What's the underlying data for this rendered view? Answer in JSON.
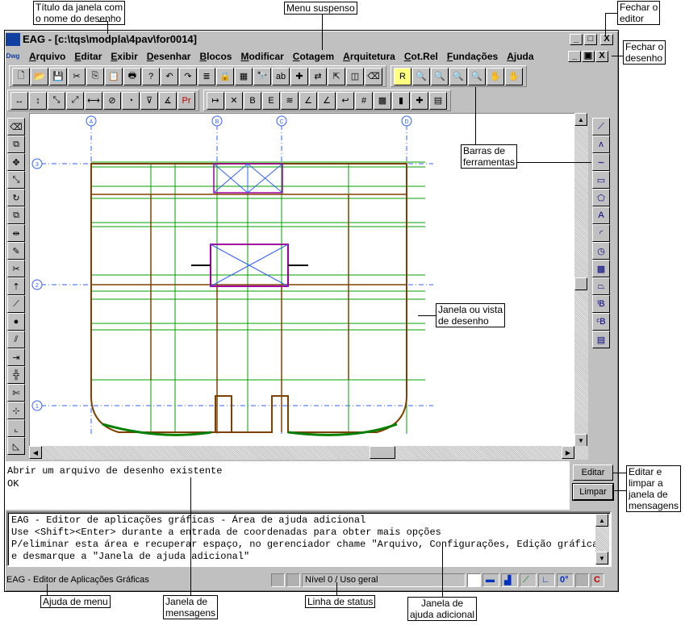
{
  "window": {
    "title": "EAG - [c:\\tqs\\modpla\\4pav\\for0014]",
    "logo": "TQS",
    "doc_logo": "Dwg",
    "min": "_",
    "max": "□",
    "close": "X",
    "doc_min": "_",
    "doc_restore": "▣",
    "doc_close": "X"
  },
  "menu": [
    "Arquivo",
    "Editar",
    "Exibir",
    "Desenhar",
    "Blocos",
    "Modificar",
    "Cotagem",
    "Arquitetura",
    "Cot.Rel",
    "Fundações",
    "Ajuda"
  ],
  "toolbar1": [
    {
      "icon": "new-icon",
      "g": "🗋"
    },
    {
      "icon": "open-icon",
      "g": "📂"
    },
    {
      "icon": "save-icon",
      "g": "💾"
    },
    {
      "icon": "cut-icon",
      "g": "✂"
    },
    {
      "icon": "copy-icon",
      "g": "⎘"
    },
    {
      "icon": "paste-icon",
      "g": "📋"
    },
    {
      "icon": "print-icon",
      "g": "🖶"
    },
    {
      "icon": "help-icon",
      "g": "?"
    },
    {
      "icon": "undo-icon",
      "g": "↶"
    },
    {
      "icon": "redo-icon",
      "g": "↷"
    },
    {
      "icon": "layers-icon",
      "g": "≣"
    },
    {
      "icon": "lock-icon",
      "g": "🔒"
    },
    {
      "icon": "colors-icon",
      "g": "▦"
    },
    {
      "icon": "find-icon",
      "g": "🔭"
    },
    {
      "icon": "text-replace-icon",
      "g": "ab"
    },
    {
      "icon": "cross-icon",
      "g": "✚"
    },
    {
      "icon": "swap-icon",
      "g": "⇄"
    },
    {
      "icon": "export-icon",
      "g": "⇱"
    },
    {
      "icon": "window-icon",
      "g": "◫"
    },
    {
      "icon": "eraser-icon",
      "g": "⌫"
    }
  ],
  "toolbar_zoom": [
    {
      "icon": "redraw-icon",
      "g": "R"
    },
    {
      "icon": "zoom-window-icon",
      "g": "🔍"
    },
    {
      "icon": "zoom-previous-icon",
      "g": "🔍"
    },
    {
      "icon": "zoom-out-icon",
      "g": "🔍"
    },
    {
      "icon": "zoom-all-icon",
      "g": "🔍"
    },
    {
      "icon": "pan-icon",
      "g": "✋"
    },
    {
      "icon": "pan-realtime-icon",
      "g": "✋"
    }
  ],
  "toolbar_dim": [
    {
      "icon": "dim-horizontal-icon",
      "g": "↔"
    },
    {
      "icon": "dim-vertical-icon",
      "g": "↕"
    },
    {
      "icon": "dim-aligned-icon",
      "g": "⤡"
    },
    {
      "icon": "dim-rotated-icon",
      "g": "⤢"
    },
    {
      "icon": "dim-continuous-icon",
      "g": "⟷"
    },
    {
      "icon": "dim-diameter-icon",
      "g": "⊘"
    },
    {
      "icon": "dim-radius-icon",
      "g": "◔"
    },
    {
      "icon": "dim-level-icon",
      "g": "⊽"
    },
    {
      "icon": "dim-angle-icon",
      "g": "∡"
    },
    {
      "icon": "dim-properties-icon",
      "g": "Pr"
    }
  ],
  "toolbar_cotrel": [
    {
      "icon": "cotrel-1-icon",
      "g": "↦"
    },
    {
      "icon": "cotrel-2-icon",
      "g": "✕"
    },
    {
      "icon": "cotrel-3-icon",
      "g": "B"
    },
    {
      "icon": "cotrel-4-icon",
      "g": "E"
    },
    {
      "icon": "cotrel-5-icon",
      "g": "≋"
    },
    {
      "icon": "cotrel-6-icon",
      "g": "∠"
    },
    {
      "icon": "cotrel-7-icon",
      "g": "∠"
    },
    {
      "icon": "cotrel-8-icon",
      "g": "↩"
    },
    {
      "icon": "cotrel-9-icon",
      "g": "#"
    },
    {
      "icon": "cotrel-10-icon",
      "g": "▩"
    },
    {
      "icon": "cotrel-11-icon",
      "g": "▮"
    },
    {
      "icon": "cotrel-12-icon",
      "g": "✚"
    },
    {
      "icon": "cotrel-13-icon",
      "g": "▤"
    }
  ],
  "left_toolbar": [
    {
      "icon": "erase-icon",
      "g": "⌫"
    },
    {
      "icon": "copy-object-icon",
      "g": "⧉"
    },
    {
      "icon": "move-icon",
      "g": "✥"
    },
    {
      "icon": "stretch-icon",
      "g": "⤡"
    },
    {
      "icon": "rotate-icon",
      "g": "↻"
    },
    {
      "icon": "scale-icon",
      "g": "⧉"
    },
    {
      "icon": "mirror-icon",
      "g": "⇹"
    },
    {
      "icon": "edit-icon",
      "g": "✎"
    },
    {
      "icon": "trim-icon",
      "g": "✂"
    },
    {
      "icon": "extend-icon",
      "g": "⇡"
    },
    {
      "icon": "break-icon",
      "g": "⟋"
    },
    {
      "icon": "point-icon",
      "g": "●"
    },
    {
      "icon": "offset-icon",
      "g": "⫽"
    },
    {
      "icon": "divide-icon",
      "g": "⇥"
    },
    {
      "icon": "join-icon",
      "g": "╬"
    },
    {
      "icon": "scissors-icon",
      "g": "✄"
    },
    {
      "icon": "measure-icon",
      "g": "⊹"
    },
    {
      "icon": "fillet-icon",
      "g": "⌞"
    },
    {
      "icon": "chamfer-icon",
      "g": "◺"
    }
  ],
  "right_toolbar": [
    {
      "icon": "line-icon",
      "g": "⟋"
    },
    {
      "icon": "polyline-icon",
      "g": "ʌ"
    },
    {
      "icon": "curve-icon",
      "g": "∼"
    },
    {
      "icon": "rectangle-icon",
      "g": "▭"
    },
    {
      "icon": "polygon-icon",
      "g": "⬠"
    },
    {
      "icon": "text-icon",
      "g": "A"
    },
    {
      "icon": "arc-icon",
      "g": "◜"
    },
    {
      "icon": "circle-icon",
      "g": "◷"
    },
    {
      "icon": "hatch-icon",
      "g": "▩"
    },
    {
      "icon": "block-insert-icon",
      "g": "⏢"
    },
    {
      "icon": "block-i-icon",
      "g": "ᴵB"
    },
    {
      "icon": "block-c-icon",
      "g": "ᶜB"
    },
    {
      "icon": "block-list-icon",
      "g": "▤"
    }
  ],
  "drawing": {
    "axes_x": [
      "A",
      "B",
      "C",
      "D"
    ],
    "axes_y": [
      "3",
      "2",
      "1"
    ]
  },
  "messages": {
    "lines": [
      "Abrir um arquivo de desenho existente",
      "OK"
    ],
    "edit_button": "Editar",
    "clear_button": "Limpar"
  },
  "help": {
    "lines": [
      "EAG - Editor de aplicações gráficas - Área de ajuda adicional",
      "Use <Shift><Enter> durante a entrada de coordenadas para obter mais opções",
      "P/eliminar esta área e recuperar espaço, no gerenciador chame \"Arquivo, Configurações, Edição gráfica\"",
      "e desmarque a \"Janela de ajuda adicional\""
    ]
  },
  "status": {
    "menu_help": "EAG - Editor de Aplicações Gráficas",
    "level": "Nível 0 / Uso geral",
    "angle": "0°"
  },
  "callouts": {
    "title": "Título da janela com\no nome do desenho",
    "menu": "Menu suspenso",
    "close_editor": "Fechar o\neditor",
    "close_drawing": "Fechar o\ndesenho",
    "toolbars": "Barras de\nferramentas",
    "view": "Janela ou vista\nde desenho",
    "edit_clear": "Editar e\nlimpar a\njanela de\nmensagens",
    "menu_help": "Ajuda de menu",
    "messages": "Janela de\nmensagens",
    "status": "Linha de status",
    "help": "Janela de\najuda adicional"
  }
}
